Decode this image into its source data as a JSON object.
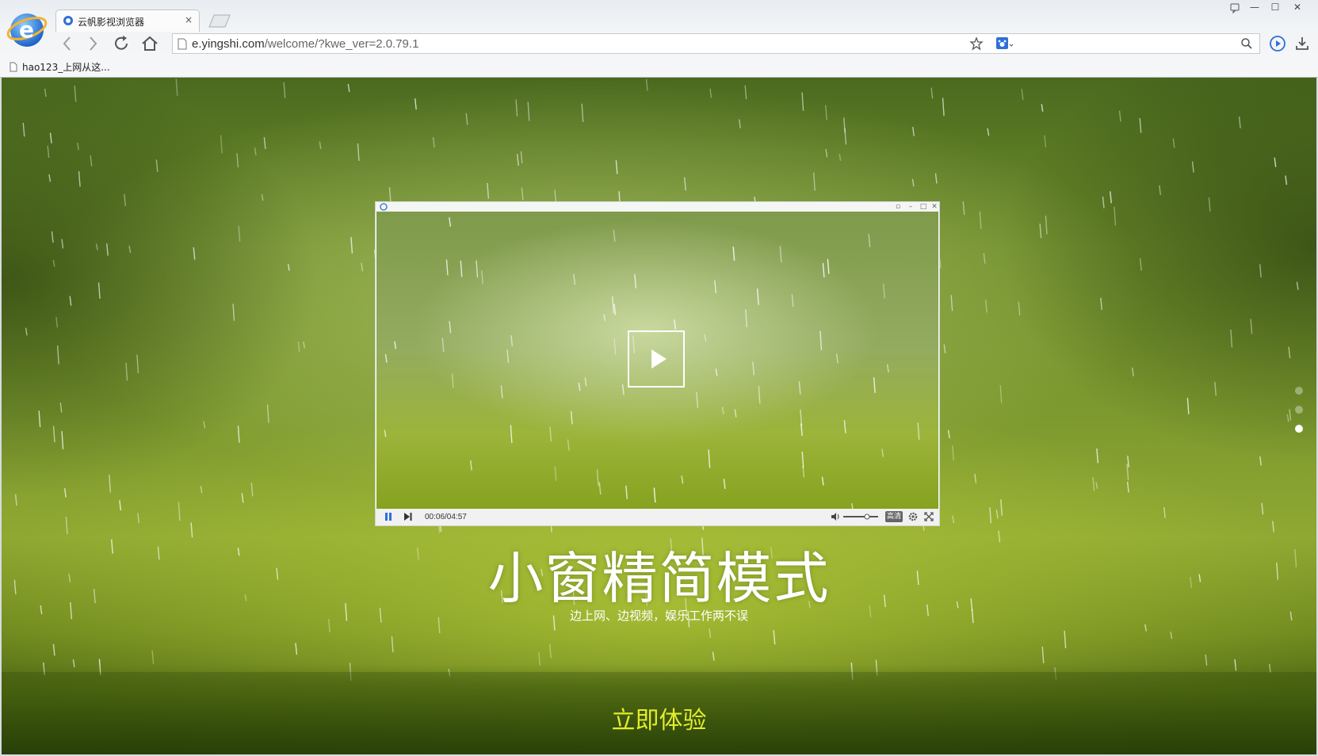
{
  "browser": {
    "tab_title": "云帆影视浏览器",
    "tab_close": "×",
    "url_host": "e.yingshi.com",
    "url_path": "/welcome/?kwe_ver=2.0.79.1",
    "bookmark_label": "hao123_上网从这...",
    "window_controls": {
      "feedback": "feedback-icon",
      "minimize": "—",
      "maximize": "☐",
      "close": "✕"
    }
  },
  "player": {
    "time": "00:06/04:57",
    "hd_label": "高清"
  },
  "hero": {
    "headline": "小窗精简模式",
    "subline": "边上网、边视频，娱乐工作两不误",
    "cta": "立即体验"
  },
  "pager": {
    "count": 3,
    "active_index": 2
  },
  "colors": {
    "cta": "#e3ec2b",
    "accent_blue": "#2f6fd6",
    "headline": "#ffffff"
  }
}
